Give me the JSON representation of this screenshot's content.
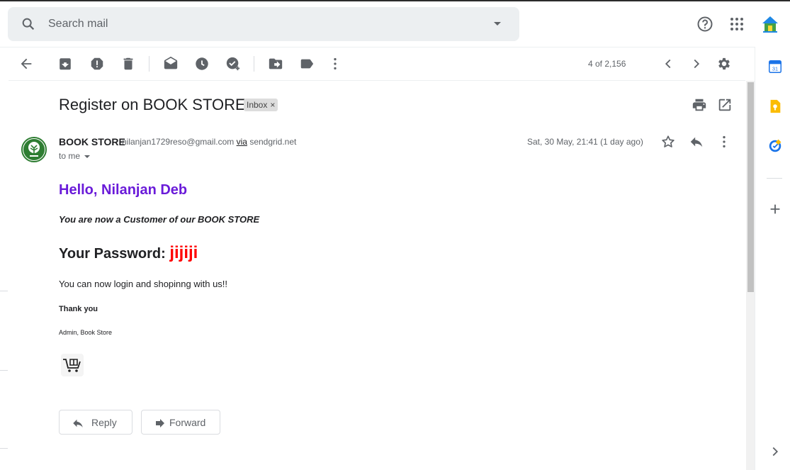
{
  "header": {
    "search_placeholder": "Search mail"
  },
  "toolbar": {
    "pager": "4 of 2,156"
  },
  "email": {
    "subject": "Register on BOOK STORE",
    "label": "Inbox",
    "label_close": "×",
    "sender_name": "BOOK STORE",
    "sender_email": "nilanjan1729reso@gmail.com",
    "via_label": "via",
    "via_domain": "sendgrid.net",
    "to_me": "to me",
    "date": "Sat, 30 May, 21:41 (1 day ago)"
  },
  "body": {
    "greeting": "Hello, Nilanjan Deb",
    "customer_line": "You are now a Customer of our BOOK STORE",
    "password_label": "Your Password: ",
    "password_value": "jijiji",
    "login_line": "You can now login and shopinng with us!!",
    "thanks": "Thank you",
    "signature": "Admin, Book Store"
  },
  "actions": {
    "reply": "Reply",
    "forward": "Forward"
  },
  "colors": {
    "greeting": "#6a1bd9",
    "password": "#ff0000",
    "avatar_ring": "#2e7d32"
  }
}
